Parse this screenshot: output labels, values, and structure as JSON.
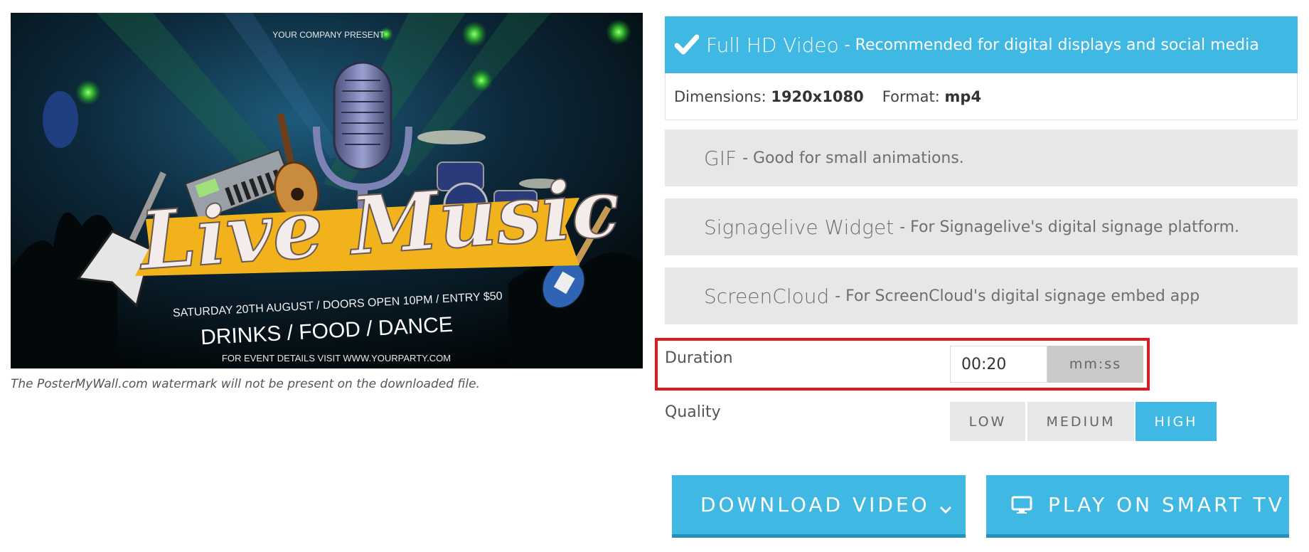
{
  "preview": {
    "company": "YOUR COMPANY PRESENT",
    "title": "Live Music",
    "line1": "SATURDAY 20TH AUGUST / DOORS OPEN 10PM  / ENTRY $50",
    "line2": "DRINKS  / FOOD / DANCE",
    "line3": "FOR EVENT DETAILS VISIT WWW.YOURPARTY.COM",
    "caption": "The PosterMyWall.com watermark will not be present on the downloaded file."
  },
  "formats": [
    {
      "name": "Full HD Video",
      "desc": "- Recommended for digital displays and social media",
      "selected": true
    },
    {
      "name": "GIF",
      "desc": "- Good for small animations.",
      "selected": false
    },
    {
      "name": "Signagelive Widget",
      "desc": "- For Signagelive's digital signage platform.",
      "selected": false
    },
    {
      "name": "ScreenCloud",
      "desc": "- For ScreenCloud's digital signage embed app",
      "selected": false
    }
  ],
  "details": {
    "dimensions_label": "Dimensions:",
    "dimensions_value": "1920x1080",
    "format_label": "Format:",
    "format_value": "mp4"
  },
  "duration": {
    "label": "Duration",
    "value": "00:20",
    "unit": "mm:ss"
  },
  "quality": {
    "label": "Quality",
    "options": [
      "LOW",
      "MEDIUM",
      "HIGH"
    ],
    "selected": "HIGH"
  },
  "actions": {
    "download_label": "DOWNLOAD VIDEO",
    "smart_tv_label": "PLAY ON SMART TV"
  },
  "colors": {
    "accent": "#3fb8e3",
    "highlight_border": "#e0191f",
    "banner_yellow": "#f2b21c"
  },
  "icons": {
    "check": "check-icon",
    "chevron": "chevron-down-icon",
    "tv": "monitor-icon"
  }
}
